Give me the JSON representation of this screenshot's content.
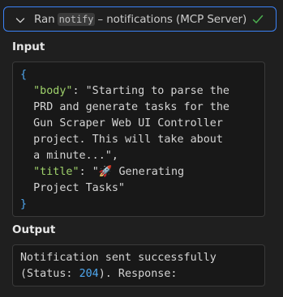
{
  "header": {
    "prefix": "Ran",
    "tool_name": "notify",
    "suffix": "– notifications (MCP Server)",
    "status_icon": "check-icon",
    "accent_color": "#3b82f6",
    "success_color": "#4caf50"
  },
  "input": {
    "label": "Input",
    "open_brace": "{",
    "close_brace": "}",
    "body_key": "\"body\"",
    "body_colon": ": ",
    "body_line1": "\"Starting to parse the",
    "body_line2": "PRD and generate tasks for the",
    "body_line3": "Gun Scraper Web UI Controller",
    "body_line4": "project. This will take about",
    "body_line5": "a minute...\",",
    "title_key": "\"title\"",
    "title_colon": ": ",
    "title_line1": "\"🚀 Generating",
    "title_line2": "Project Tasks\""
  },
  "output": {
    "label": "Output",
    "line1": "Notification sent successfully",
    "line2_prefix": "(Status: ",
    "status_code": "204",
    "line2_suffix": "). Response:"
  }
}
